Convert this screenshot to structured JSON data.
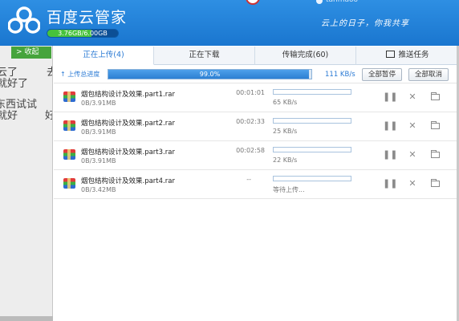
{
  "app": {
    "title": "百度云管家",
    "quota": "3.76GB/6.00GB",
    "quota_fraction": 0.63,
    "slogan": "云上的日子，你我共享",
    "user": "tanmaoo"
  },
  "sidebar": {
    "collapse_label": "收起",
    "bg_lines": [
      "云了",
      "去",
      "就好了",
      "东西试试",
      "就好",
      "好"
    ]
  },
  "tabs": [
    {
      "label": "正在上传(4)"
    },
    {
      "label": "正在下载"
    },
    {
      "label": "传输完成(60)"
    },
    {
      "label": "推送任务"
    }
  ],
  "progress": {
    "label": "上传总进度",
    "percent_text": "99.0%",
    "percent": 99.0,
    "speed": "111 KB/s",
    "pause_all": "全部暂停",
    "cancel_all": "全部取消"
  },
  "files": [
    {
      "name": "烟包结构设计及效果.part1.rar",
      "size": "0B/3.91MB",
      "time": "00:01:01",
      "progress": 0,
      "speed": "65 KB/s"
    },
    {
      "name": "烟包结构设计及效果.part2.rar",
      "size": "0B/3.91MB",
      "time": "00:02:33",
      "progress": 0,
      "speed": "25 KB/s"
    },
    {
      "name": "烟包结构设计及效果.part3.rar",
      "size": "0B/3.91MB",
      "time": "00:02:58",
      "progress": 0,
      "speed": "22 KB/s"
    },
    {
      "name": "烟包结构设计及效果.part4.rar",
      "size": "0B/3.42MB",
      "time": "--",
      "progress": 0,
      "speed": "等待上传..."
    }
  ],
  "icons": {
    "pause": "pause-icon",
    "close": "close-icon",
    "folder": "folder-icon"
  },
  "colors": {
    "header": "#1f7fd8",
    "accent": "#2a7ad4",
    "quota_green": "#47c23c"
  }
}
